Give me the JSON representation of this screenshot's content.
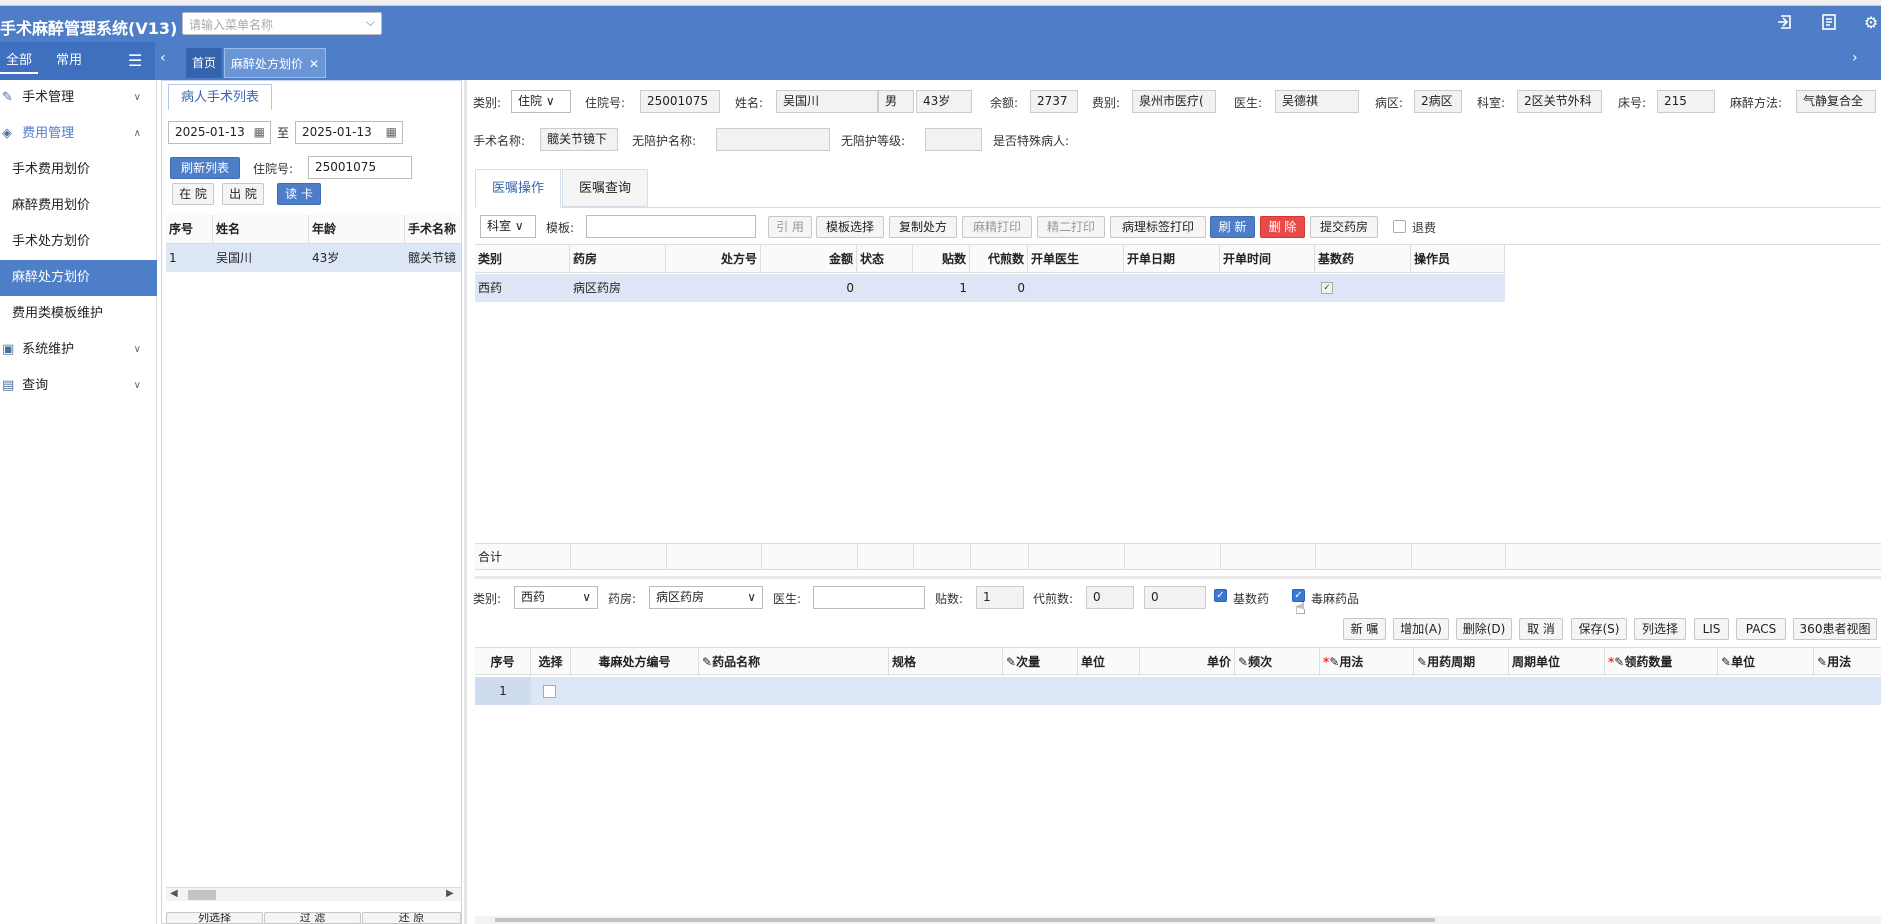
{
  "app": {
    "title": "手术麻醉管理系统(V13)",
    "menu_search_placeholder": "请输入菜单名称"
  },
  "left_tabs": [
    "全部",
    "常用"
  ],
  "page_tabs": {
    "home": "首页",
    "current": "麻醉处方划价"
  },
  "sidebar": {
    "items": [
      {
        "label": "手术管理",
        "type": "group"
      },
      {
        "label": "费用管理",
        "type": "group-open"
      },
      {
        "label": "手术费用划价",
        "type": "sub"
      },
      {
        "label": "麻醉费用划价",
        "type": "sub"
      },
      {
        "label": "手术处方划价",
        "type": "sub"
      },
      {
        "label": "麻醉处方划价",
        "type": "sub-active"
      },
      {
        "label": "费用类模板维护",
        "type": "sub"
      },
      {
        "label": "系统维护",
        "type": "group"
      },
      {
        "label": "查询",
        "type": "group"
      }
    ]
  },
  "patient_panel": {
    "tab": "病人手术列表",
    "date_from": "2025-01-13",
    "date_to_sep": "至",
    "date_to": "2025-01-13",
    "refresh_btn": "刷新列表",
    "inpatient_no_label": "住院号:",
    "inpatient_no": "25001075",
    "in_btn": "在 院",
    "out_btn": "出 院",
    "readcard_btn": "读 卡",
    "columns": [
      "序号",
      "姓名",
      "年龄",
      "手术名称"
    ],
    "rows": [
      [
        "1",
        "吴国川",
        "43岁",
        "髋关节镜"
      ]
    ],
    "footer": [
      "列选择",
      "过 滤",
      "还 原"
    ]
  },
  "patient_info": {
    "type_label": "类别:",
    "type": "住院",
    "inpatient_label": "住院号:",
    "inpatient": "25001075",
    "name_label": "姓名:",
    "name": "吴国川",
    "sex": "男",
    "age": "43岁",
    "balance_label": "余额:",
    "balance": "2737",
    "fee_label": "费别:",
    "fee": "泉州市医疗(",
    "doctor_label": "医生:",
    "doctor": "吴德祺",
    "ward_label": "病区:",
    "ward": "2病区",
    "dept_label": "科室:",
    "dept": "2区关节外科",
    "bed_label": "床号:",
    "bed": "215",
    "anes_label": "麻醉方法:",
    "anes": "气静复合全",
    "surgery_label": "手术名称:",
    "surgery": "髋关节镜下",
    "nurse_name_label": "无陪护名称:",
    "nurse_name": "",
    "nurse_level_label": "无陪护等级:",
    "nurse_level": "",
    "special_label": "是否特殊病人:"
  },
  "order_tabs": [
    "医嘱操作",
    "医嘱查询"
  ],
  "order_toolbar": {
    "dept": "科室",
    "template_label": "模板:",
    "template_value": "",
    "buttons": [
      "引 用",
      "模板选择",
      "复制处方",
      "麻精打印",
      "精二打印",
      "病理标签打印",
      "刷 新",
      "删 除",
      "提交药房"
    ],
    "refund_label": "退费"
  },
  "order_table": {
    "columns": [
      "类别",
      "药房",
      "处方号",
      "金额",
      "状态",
      "贴数",
      "代煎数",
      "开单医生",
      "开单日期",
      "开单时间",
      "基数药",
      "操作员"
    ],
    "rows": [
      {
        "类别": "西药",
        "药房": "病区药房",
        "处方号": "",
        "金额": "0",
        "状态": "",
        "贴数": "1",
        "代煎数": "0",
        "基数药": true
      }
    ],
    "total_label": "合计"
  },
  "detail_bar": {
    "type_label": "类别:",
    "type": "西药",
    "pharmacy_label": "药房:",
    "pharmacy": "病区药房",
    "doctor_label": "医生:",
    "doctor": "",
    "tie_label": "贴数:",
    "tie": "1",
    "decoct_label": "代煎数:",
    "decoct1": "0",
    "decoct2": "0",
    "base_label": "基数药",
    "base_checked": true,
    "narcotic_label": "毒麻药品",
    "narcotic_checked": true
  },
  "detail_buttons": [
    "新 嘱",
    "增加(A)",
    "删除(D)",
    "取 消",
    "保存(S)",
    "列选择",
    "LIS",
    "PACS",
    "360患者视图"
  ],
  "detail_table": {
    "columns": [
      "序号",
      "选择",
      "毒麻处方编号",
      "药品名称",
      "规格",
      "次量",
      "单位",
      "单价",
      "频次",
      "用法",
      "用药周期",
      "周期单位",
      "领药数量",
      "单位",
      "用法"
    ],
    "rows": [
      {
        "序号": "1"
      }
    ]
  }
}
